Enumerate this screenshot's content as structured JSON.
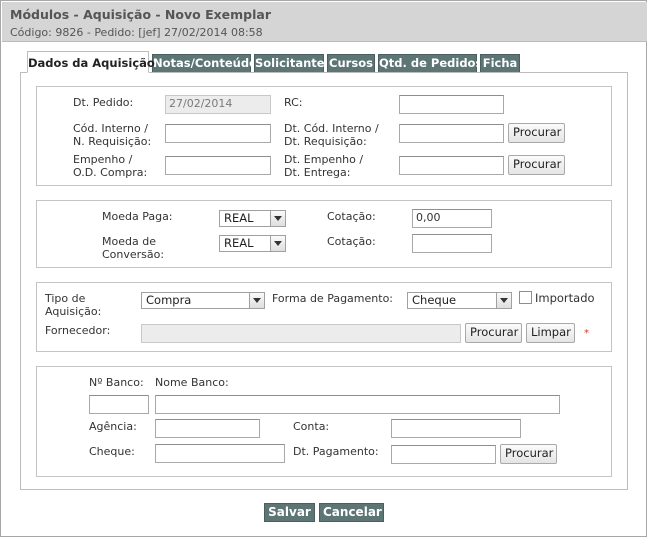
{
  "header": {
    "title": "Módulos - Aquisição - Novo Exemplar",
    "subtitle": "Código: 9826 - Pedido: [jef] 27/02/2014 08:58"
  },
  "tabs": [
    {
      "label": "Dados da Aquisição",
      "active": true
    },
    {
      "label": "Notas/Conteúdo",
      "active": false
    },
    {
      "label": "Solicitante",
      "active": false
    },
    {
      "label": "Cursos",
      "active": false
    },
    {
      "label": "Qtd. de Pedidos",
      "active": false
    },
    {
      "label": "Ficha",
      "active": false
    }
  ],
  "section1": {
    "dt_pedido_label": "Dt. Pedido:",
    "dt_pedido_value": "27/02/2014",
    "rc_label": "RC:",
    "cod_interno_label_1": "Cód. Interno /",
    "cod_interno_label_2": "N. Requisição:",
    "dt_cod_interno_label_1": "Dt. Cód. Interno /",
    "dt_cod_interno_label_2": "Dt. Requisição:",
    "empenho_label_1": "Empenho /",
    "empenho_label_2": "O.D. Compra:",
    "dt_empenho_label_1": "Dt. Empenho /",
    "dt_empenho_label_2": "Dt. Entrega:",
    "procurar_label": "Procurar"
  },
  "section2": {
    "moeda_paga_label": "Moeda Paga:",
    "moeda_paga_value": "REAL",
    "cotacao_label": "Cotação:",
    "cotacao_value": "0,00",
    "moeda_conversao_label_1": "Moeda de",
    "moeda_conversao_label_2": "Conversão:",
    "moeda_conversao_value": "REAL",
    "cotacao2_label": "Cotação:"
  },
  "section3": {
    "tipo_label_1": "Tipo de",
    "tipo_label_2": "Aquisição:",
    "tipo_value": "Compra",
    "forma_label": "Forma de Pagamento:",
    "forma_value": "Cheque",
    "importado_label": "Importado",
    "fornecedor_label": "Fornecedor:",
    "procurar_label": "Procurar",
    "limpar_label": "Limpar",
    "required_mark": "*"
  },
  "section4": {
    "n_banco_label": "Nº Banco:",
    "nome_banco_label": "Nome Banco:",
    "agencia_label": "Agência:",
    "conta_label": "Conta:",
    "cheque_label": "Cheque:",
    "dt_pagamento_label": "Dt. Pagamento:",
    "procurar_label": "Procurar"
  },
  "actions": {
    "salvar_label": "Salvar",
    "cancelar_label": "Cancelar"
  }
}
